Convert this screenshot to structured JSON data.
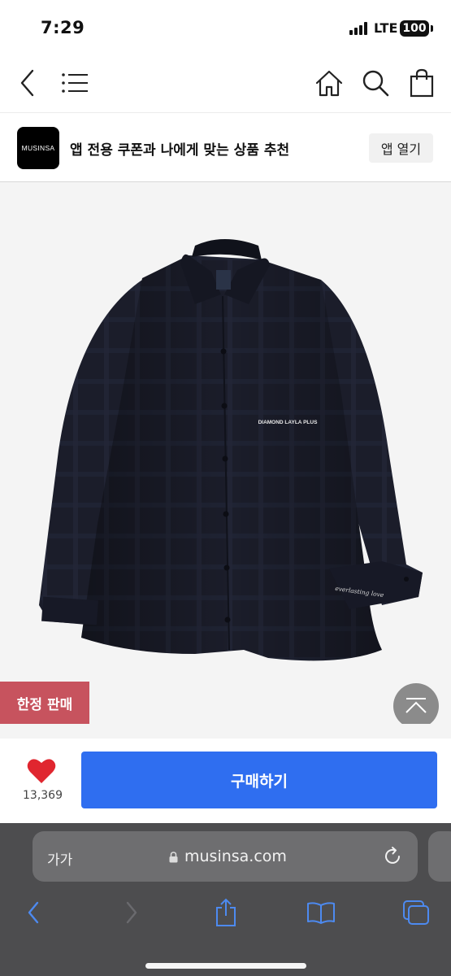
{
  "status_bar": {
    "time": "7:29",
    "network": "LTE",
    "battery": "100"
  },
  "nav": {
    "back_icon": "chevron-left-icon",
    "menu_icon": "hamburger-menu-icon",
    "home_icon": "home-icon",
    "search_icon": "search-icon",
    "bag_icon": "shopping-bag-icon"
  },
  "app_banner": {
    "logo_text": "MUSINSA",
    "promo_text": "앱 전용 쿠폰과 나에게 맞는 상품 추천",
    "open_button": "앱 열기"
  },
  "product": {
    "badge": "한정 판매",
    "badge_color": "#c7535e",
    "print_text": "DIAMOND LAYLA PLUS",
    "cuff_text": "everlasting love"
  },
  "purchase": {
    "like_count": "13,369",
    "buy_label": "구매하기",
    "accent": "#2f6ef0"
  },
  "browser": {
    "text_size_label": "가가",
    "url": "musinsa.com",
    "toolbar_icons": [
      "back-icon",
      "forward-icon",
      "share-icon",
      "bookmarks-icon",
      "tabs-icon"
    ],
    "tint": "#4d8af0"
  }
}
